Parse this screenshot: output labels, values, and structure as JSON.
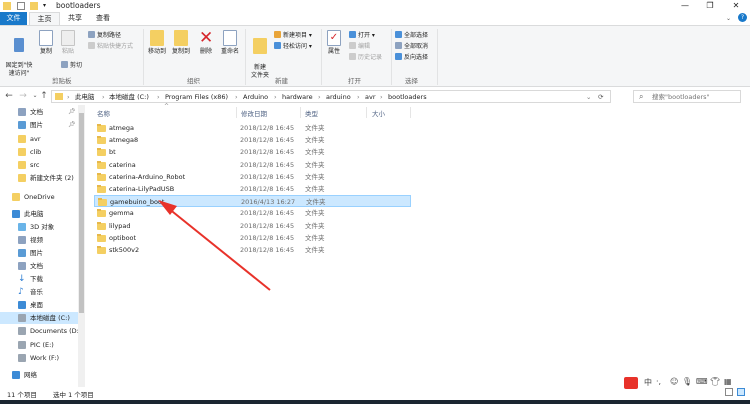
{
  "window": {
    "title": "bootloaders",
    "minimize": "—",
    "maximize": "❐",
    "close": "✕"
  },
  "ribbon_tabs": [
    "文件",
    "主页",
    "共享",
    "查看"
  ],
  "ribbon": {
    "clipboard": {
      "pin": "固定到\"快\n速访问\"",
      "copy": "复制",
      "paste": "粘贴",
      "copy_path": "复制路径",
      "paste_shortcut": "粘贴快捷方式",
      "cut": "剪切",
      "label": "剪贴板"
    },
    "organize": {
      "move_to": "移动到",
      "copy_to": "复制到",
      "delete": "删除",
      "rename": "重命名",
      "label": "组织"
    },
    "new": {
      "new_folder": "新建\n文件夹",
      "new_item": "新建项目 ▾",
      "easy_access": "轻松访问 ▾",
      "label": "新建"
    },
    "open": {
      "properties": "属性",
      "open": "打开 ▾",
      "edit": "编辑",
      "history": "历史记录",
      "label": "打开"
    },
    "select": {
      "select_all": "全部选择",
      "select_none": "全部取消",
      "invert": "反向选择",
      "label": "选择"
    }
  },
  "address": {
    "crumbs": [
      "此电脑",
      "本地磁盘 (C:)",
      "Program Files (x86)",
      "Arduino",
      "hardware",
      "arduino",
      "avr",
      "bootloaders"
    ],
    "search_placeholder": "搜索\"bootloaders\""
  },
  "nav": {
    "quick": [
      "文档",
      "图片",
      "avr",
      "clib",
      "src",
      "新建文件夹 (2)"
    ],
    "onedrive": "OneDrive",
    "thispc": "此电脑",
    "pc_items": [
      "3D 对象",
      "视频",
      "图片",
      "文档",
      "下载",
      "音乐",
      "桌面",
      "本地磁盘 (C:)",
      "Documents (D:",
      "PIC (E:)",
      "Work (F:)"
    ],
    "network": "网络"
  },
  "columns": {
    "name": "名称",
    "date": "修改日期",
    "type": "类型",
    "size": "大小"
  },
  "files": [
    {
      "name": "atmega",
      "date": "2018/12/8 16:45",
      "type": "文件夹"
    },
    {
      "name": "atmega8",
      "date": "2018/12/8 16:45",
      "type": "文件夹"
    },
    {
      "name": "bt",
      "date": "2018/12/8 16:45",
      "type": "文件夹"
    },
    {
      "name": "caterina",
      "date": "2018/12/8 16:45",
      "type": "文件夹"
    },
    {
      "name": "caterina-Arduino_Robot",
      "date": "2018/12/8 16:45",
      "type": "文件夹"
    },
    {
      "name": "caterina-LilyPadUSB",
      "date": "2018/12/8 16:45",
      "type": "文件夹"
    },
    {
      "name": "gamebuino_boot",
      "date": "2016/4/13 16:27",
      "type": "文件夹"
    },
    {
      "name": "gemma",
      "date": "2018/12/8 16:45",
      "type": "文件夹"
    },
    {
      "name": "lilypad",
      "date": "2018/12/8 16:45",
      "type": "文件夹"
    },
    {
      "name": "optiboot",
      "date": "2018/12/8 16:45",
      "type": "文件夹"
    },
    {
      "name": "stk500v2",
      "date": "2018/12/8 16:45",
      "type": "文件夹"
    }
  ],
  "status": {
    "count": "11 个项目",
    "selected": "选中 1 个项目"
  },
  "colors": {
    "accent": "#1979ca",
    "selection": "#cce8ff",
    "folder": "#f4cf62",
    "annotation_arrow": "#e8322a"
  }
}
